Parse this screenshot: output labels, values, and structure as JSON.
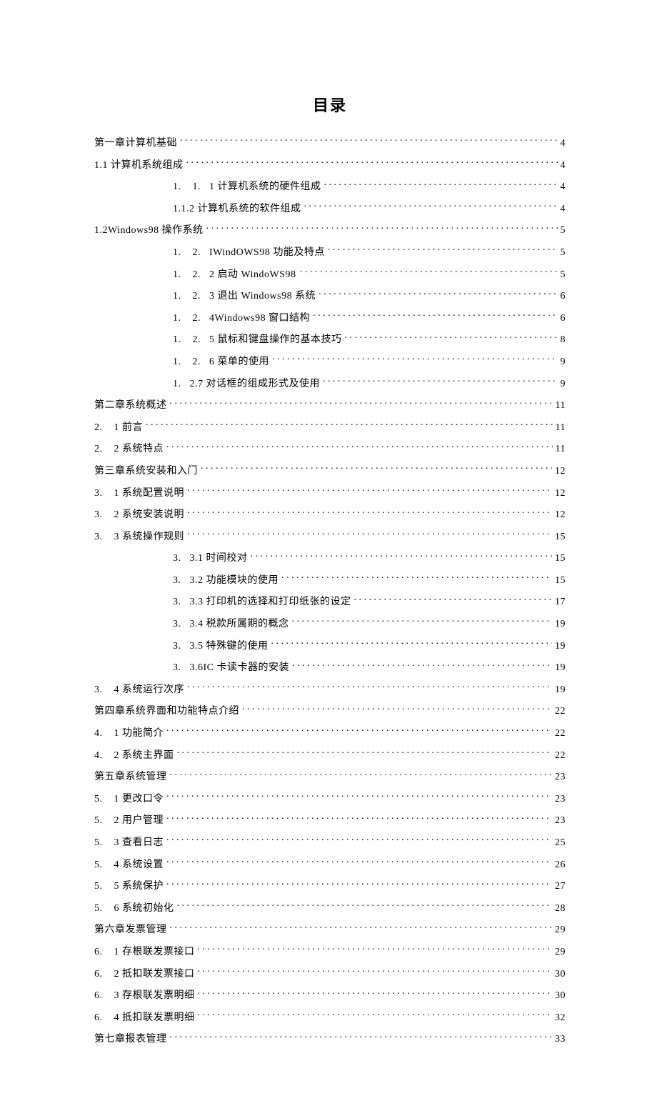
{
  "title": "目录",
  "toc": [
    {
      "indent": "indent-0",
      "text": "第一章计算机基础",
      "page": "4"
    },
    {
      "indent": "indent-0",
      "text": "1.1 计算机系统组成",
      "page": "4"
    },
    {
      "indent": "indent-1c",
      "text": "1.    1.   1 计算机系统的硬件组成",
      "page": "4"
    },
    {
      "indent": "indent-1c",
      "text": "1.1.2 计算机系统的软件组成",
      "page": "4"
    },
    {
      "indent": "indent-0",
      "text": "1.2Windows98 操作系统",
      "page": "5"
    },
    {
      "indent": "indent-1c",
      "text": "1.    2.   IWindOWS98 功能及特点",
      "page": "5"
    },
    {
      "indent": "indent-1c",
      "text": "1.    2.   2 启动 WindoWS98",
      "page": "5",
      "rightLeader": true
    },
    {
      "indent": "indent-1c",
      "text": "1.    2.   3 退出 Windows98 系统",
      "page": "6"
    },
    {
      "indent": "indent-1c",
      "text": "1.    2.   4Windows98 窗口结构",
      "page": "6"
    },
    {
      "indent": "indent-1c",
      "text": "1.    2.   5 鼠标和键盘操作的基本技巧",
      "page": "8"
    },
    {
      "indent": "indent-1c",
      "text": "1.    2.   6 菜单的使用",
      "page": "9"
    },
    {
      "indent": "indent-1c",
      "text": "1.   2.7 对话框的组成形式及使用",
      "page": "9"
    },
    {
      "indent": "indent-0",
      "text": "第二章系统概述",
      "page": "11"
    },
    {
      "indent": "indent-0",
      "text": "2.    1 前言",
      "page": "11"
    },
    {
      "indent": "indent-0",
      "text": "2.    2 系统特点",
      "page": "11"
    },
    {
      "indent": "indent-0",
      "text": "第三章系统安装和入门",
      "page": "12"
    },
    {
      "indent": "indent-0",
      "text": "3.    1 系统配置说明",
      "page": "12"
    },
    {
      "indent": "indent-0",
      "text": "3.    2 系统安装说明",
      "page": "12"
    },
    {
      "indent": "indent-0",
      "text": "3.    3 系统操作规则",
      "page": "15"
    },
    {
      "indent": "indent-1c",
      "text": "3.   3.1 时间校对",
      "page": "15"
    },
    {
      "indent": "indent-1c",
      "text": "3.   3.2 功能模块的使用",
      "page": "15"
    },
    {
      "indent": "indent-1c",
      "text": "3.   3.3 打印机的选择和打印纸张的设定",
      "page": "17"
    },
    {
      "indent": "indent-1c",
      "text": "3.   3.4 税款所属期的概念",
      "page": "19"
    },
    {
      "indent": "indent-1c",
      "text": "3.   3.5 特殊键的使用",
      "page": "19"
    },
    {
      "indent": "indent-1c",
      "text": "3.   3.6IC 卡读卡器的安装",
      "page": "19"
    },
    {
      "indent": "indent-0",
      "text": "3.    4 系统运行次序",
      "page": "19"
    },
    {
      "indent": "indent-0",
      "text": "第四章系统界面和功能特点介绍",
      "page": "22"
    },
    {
      "indent": "indent-0",
      "text": "4.    1 功能简介",
      "page": "22"
    },
    {
      "indent": "indent-0",
      "text": "4.    2 系统主界面",
      "page": "22"
    },
    {
      "indent": "indent-0",
      "text": "第五章系统管理",
      "page": "23"
    },
    {
      "indent": "indent-0",
      "text": "5.    1 更改口令",
      "page": "23"
    },
    {
      "indent": "indent-0",
      "text": "5.    2 用户管理",
      "page": "23"
    },
    {
      "indent": "indent-0",
      "text": "5.    3 查看日志",
      "page": "25"
    },
    {
      "indent": "indent-0",
      "text": "5.    4 系统设置",
      "page": "26"
    },
    {
      "indent": "indent-0",
      "text": "5.    5 系统保护",
      "page": "27"
    },
    {
      "indent": "indent-0",
      "text": "5.    6 系统初始化",
      "page": "28"
    },
    {
      "indent": "indent-0",
      "text": "第六章发票管理",
      "page": "29"
    },
    {
      "indent": "indent-0",
      "text": "6.    1 存根联发票接口",
      "page": "29"
    },
    {
      "indent": "indent-0",
      "text": "6.    2 抵扣联发票接口",
      "page": "30"
    },
    {
      "indent": "indent-0",
      "text": "6.    3 存根联发票明细",
      "page": "30"
    },
    {
      "indent": "indent-0",
      "text": "6.    4 抵扣联发票明细",
      "page": "32"
    },
    {
      "indent": "indent-0",
      "text": "第七章报表管理",
      "page": "33"
    }
  ]
}
